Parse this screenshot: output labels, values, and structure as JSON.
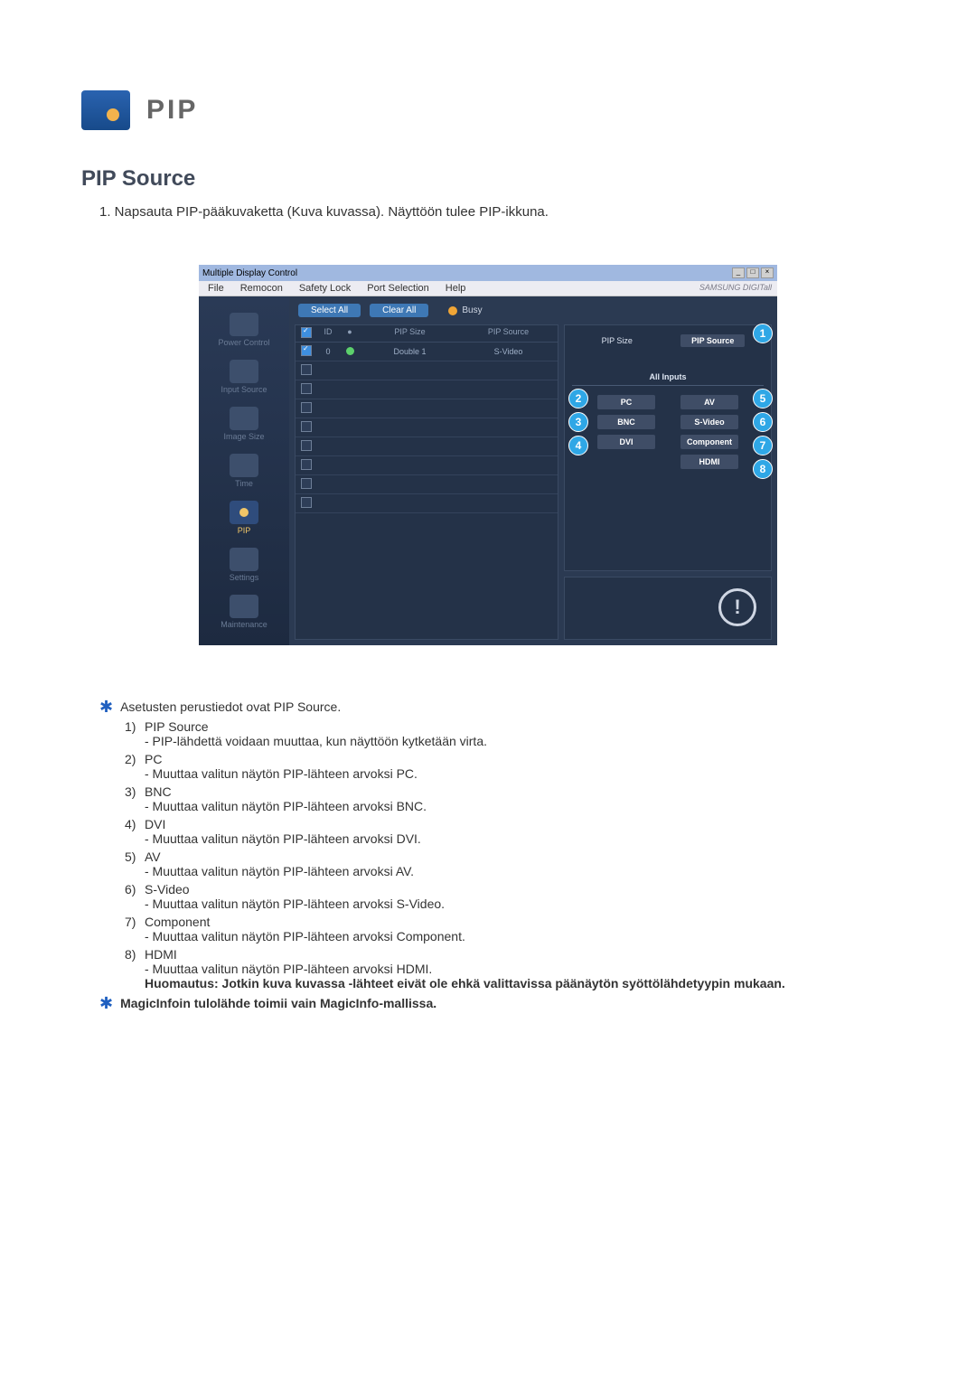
{
  "header": {
    "title": "PIP"
  },
  "section": {
    "title": "PIP Source",
    "intro": "1.  Napsauta PIP-pääkuvaketta (Kuva kuvassa). Näyttöön tulee PIP-ikkuna."
  },
  "screenshot": {
    "window_title": "Multiple Display Control",
    "menubar": [
      "File",
      "Remocon",
      "Safety Lock",
      "Port Selection",
      "Help"
    ],
    "brand": "SAMSUNG DIGITall",
    "sidebar": [
      {
        "label": "Power Control"
      },
      {
        "label": "Input Source"
      },
      {
        "label": "Image Size"
      },
      {
        "label": "Time"
      },
      {
        "label": "PIP",
        "active": true
      },
      {
        "label": "Settings"
      },
      {
        "label": "Maintenance"
      }
    ],
    "toolbar": {
      "select_all": "Select All",
      "clear_all": "Clear All",
      "busy": "Busy"
    },
    "grid": {
      "headers": {
        "chk": "✓",
        "id": "ID",
        "led": "●",
        "size": "PIP Size",
        "src": "PIP Source"
      },
      "rows": [
        {
          "checked": true,
          "id": "0",
          "led": true,
          "size": "Double 1",
          "src": "S-Video"
        },
        {
          "checked": false
        },
        {
          "checked": false
        },
        {
          "checked": false
        },
        {
          "checked": false
        },
        {
          "checked": false
        },
        {
          "checked": false
        },
        {
          "checked": false
        },
        {
          "checked": false
        }
      ]
    },
    "right": {
      "tabs": {
        "size": "PIP Size",
        "source": "PIP Source"
      },
      "all_inputs": "All Inputs",
      "pills": {
        "pc": "PC",
        "av": "AV",
        "bnc": "BNC",
        "svideo": "S-Video",
        "dvi": "DVI",
        "component": "Component",
        "hdmi": "HDMI"
      }
    },
    "callouts": {
      "b1": "1",
      "b2": "2",
      "b3": "3",
      "b4": "4",
      "b5": "5",
      "b6": "6",
      "b7": "7",
      "b8": "8"
    },
    "warn": "!"
  },
  "notes": {
    "star1": "Asetusten perustiedot ovat PIP Source.",
    "items": [
      {
        "n": "1)",
        "t": "PIP Source",
        "s": "- PIP-lähdettä voidaan muuttaa, kun näyttöön kytketään virta."
      },
      {
        "n": "2)",
        "t": "PC",
        "s": "- Muuttaa valitun näytön PIP-lähteen arvoksi PC."
      },
      {
        "n": "3)",
        "t": "BNC",
        "s": "- Muuttaa valitun näytön PIP-lähteen arvoksi BNC."
      },
      {
        "n": "4)",
        "t": "DVI",
        "s": "- Muuttaa valitun näytön PIP-lähteen arvoksi DVI."
      },
      {
        "n": "5)",
        "t": "AV",
        "s": "- Muuttaa valitun näytön PIP-lähteen arvoksi AV."
      },
      {
        "n": "6)",
        "t": "S-Video",
        "s": "- Muuttaa valitun näytön PIP-lähteen arvoksi S-Video."
      },
      {
        "n": "7)",
        "t": "Component",
        "s": "- Muuttaa valitun näytön PIP-lähteen arvoksi Component."
      },
      {
        "n": "8)",
        "t": "HDMI",
        "s": "- Muuttaa valitun näytön PIP-lähteen arvoksi HDMI."
      }
    ],
    "note_bold": "Huomautus: Jotkin kuva kuvassa -lähteet eivät ole ehkä valittavissa päänäytön syöttölähdetyypin mukaan.",
    "star2": "MagicInfoin tulolähde toimii vain MagicInfo-mallissa."
  }
}
